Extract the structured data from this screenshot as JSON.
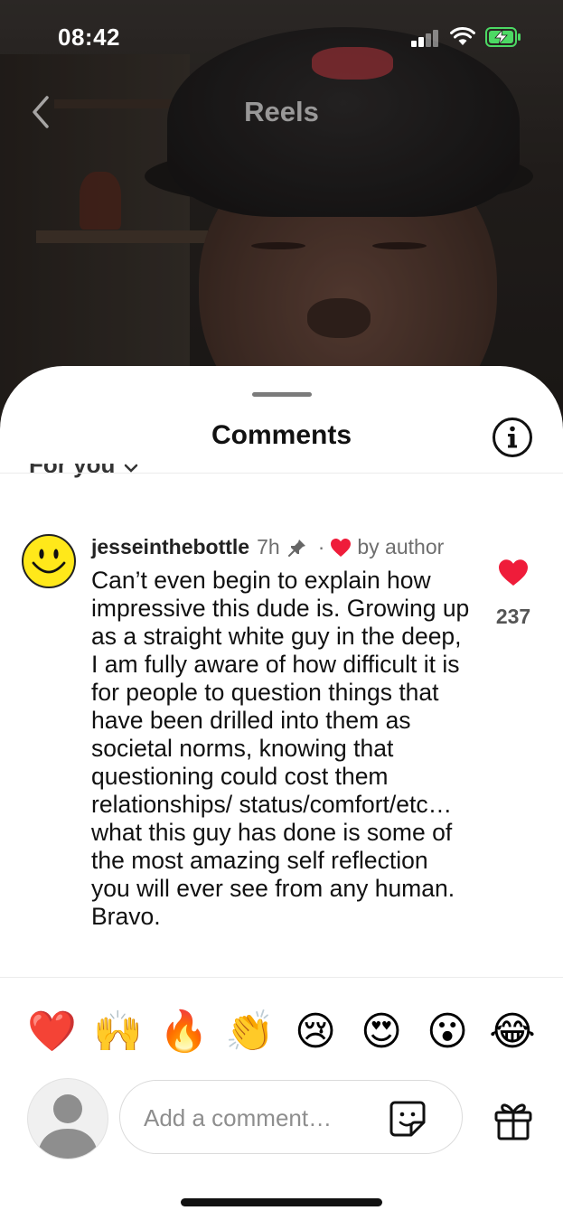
{
  "status_bar": {
    "time": "08:42"
  },
  "header": {
    "title": "Reels"
  },
  "sheet": {
    "title": "Comments",
    "filter_label": "For you"
  },
  "comment": {
    "username": "jesseinthebottle",
    "age": "7h",
    "separator": "·",
    "liked_by_author": "by author",
    "text": "Can’t even begin to explain how impressive this dude is. Growing up as a straight white guy in the deep, I am fully aware of how difficult it is for people to question things that have been drilled into them as societal norms, knowing that questioning could cost them relationships/ status/comfort/etc… what this guy has done is some of the most amazing self reflection you will ever see from any human. Bravo.",
    "like_count": "237"
  },
  "quick_reactions": [
    "❤️",
    "🙌",
    "🔥",
    "👏",
    "😢",
    "😍",
    "😮",
    "😂"
  ],
  "composer": {
    "placeholder": "Add a comment…"
  },
  "colors": {
    "heart": "#ef1c3a",
    "avatar_yellow": "#ffe81a"
  }
}
